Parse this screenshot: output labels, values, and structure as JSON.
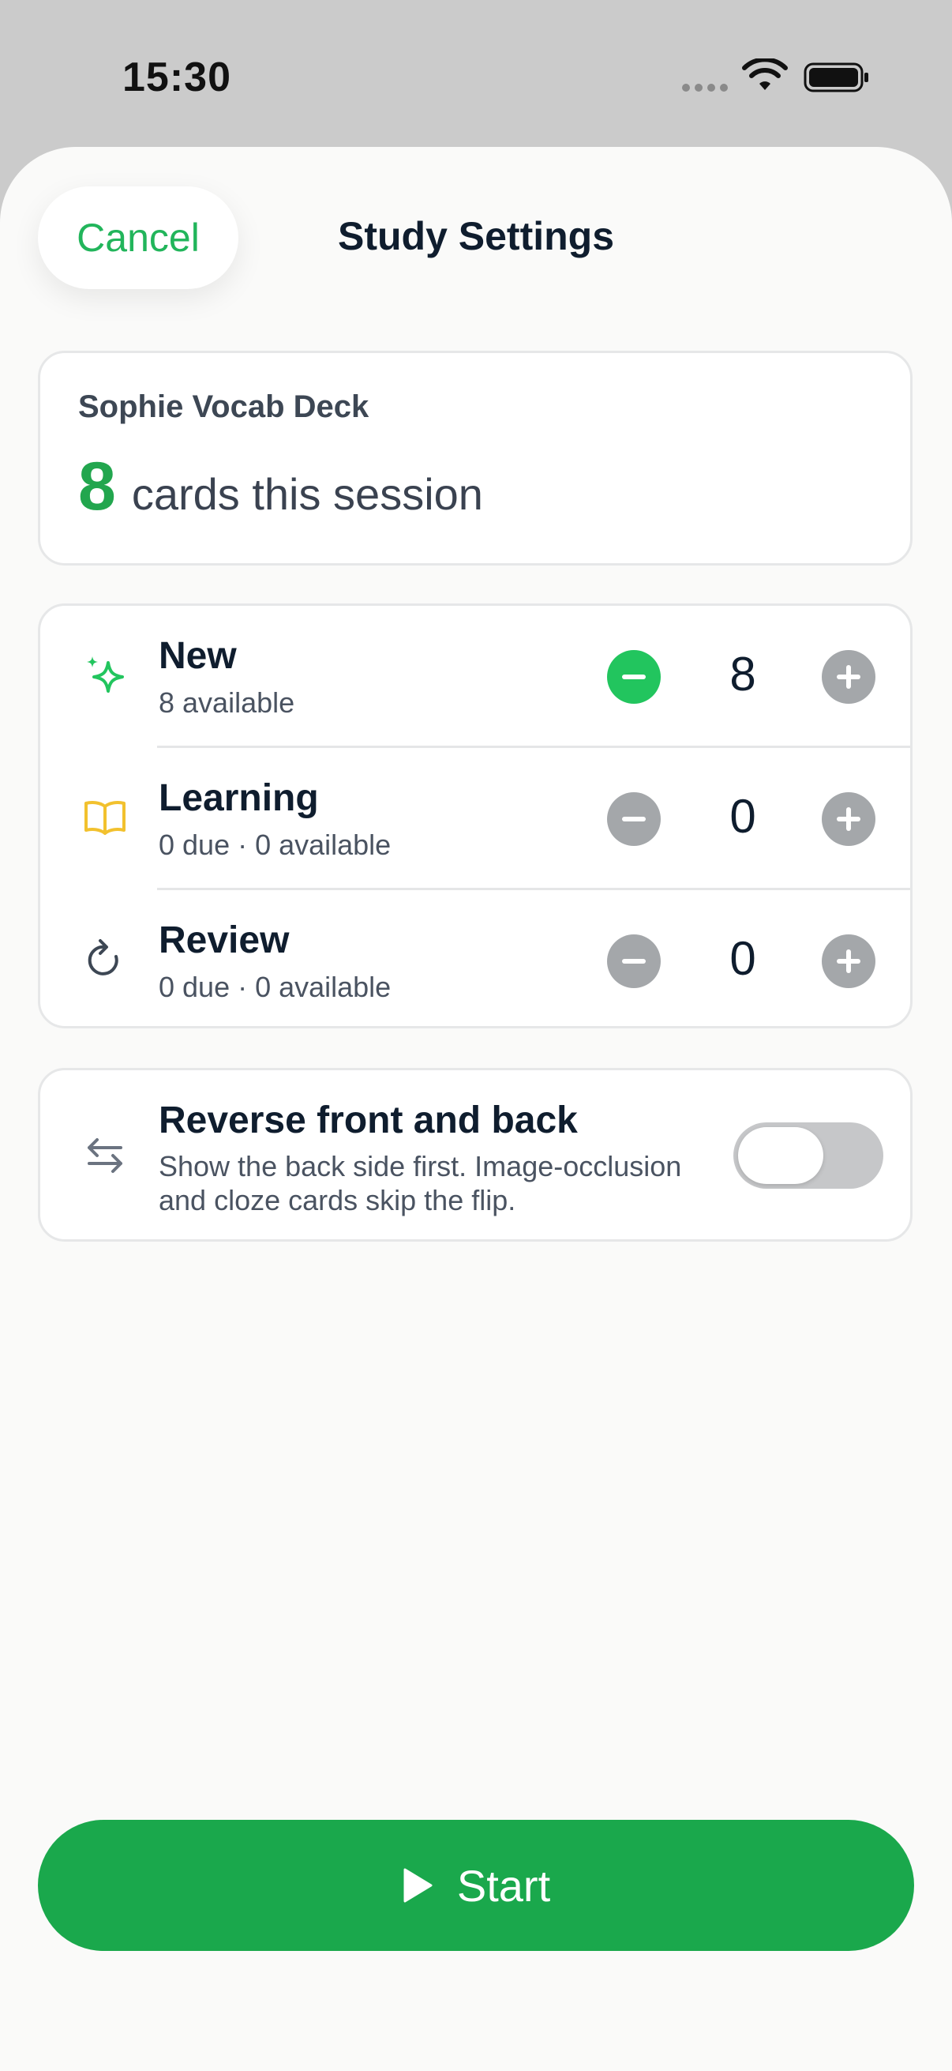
{
  "status_bar": {
    "time": "15:30",
    "wifi_icon": "wifi-icon",
    "battery_icon": "battery-icon"
  },
  "header": {
    "cancel_label": "Cancel",
    "title": "Study Settings"
  },
  "summary": {
    "deck_name": "Sophie Vocab Deck",
    "card_count": "8",
    "count_label": "cards this session"
  },
  "counts": [
    {
      "title": "New",
      "subtitle": "8 available",
      "value": "8",
      "icon": "sparkles-icon",
      "minus_enabled": true
    },
    {
      "title": "Learning",
      "subtitle": "0 due · 0 available",
      "value": "0",
      "icon": "book-icon",
      "minus_enabled": false
    },
    {
      "title": "Review",
      "subtitle": "0 due · 0 available",
      "value": "0",
      "icon": "refresh-icon",
      "minus_enabled": false
    }
  ],
  "reverse": {
    "title": "Reverse front and back",
    "description": "Show the back side first. Image-occlusion and cloze cards skip the flip.",
    "enabled": false,
    "icon": "swap-arrows-icon"
  },
  "start": {
    "label": "Start",
    "icon": "play-icon"
  },
  "colors": {
    "accent": "#22c55e",
    "start_button": "#1aa84c",
    "learning_icon": "#f2c12e",
    "text_primary": "#0f1d2e"
  }
}
